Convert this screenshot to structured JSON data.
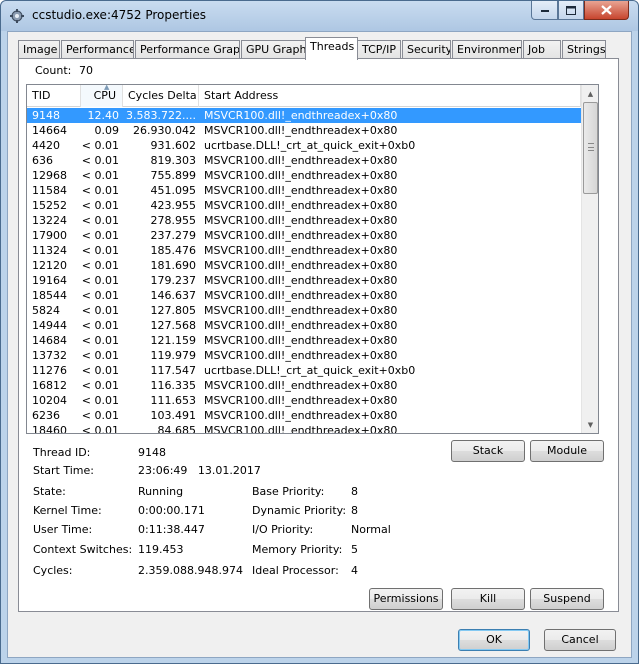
{
  "window": {
    "title": "ccstudio.exe:4752 Properties"
  },
  "tabs": [
    {
      "label": "Image"
    },
    {
      "label": "Performance"
    },
    {
      "label": "Performance Graph"
    },
    {
      "label": "GPU Graph"
    },
    {
      "label": "Threads"
    },
    {
      "label": "TCP/IP"
    },
    {
      "label": "Security"
    },
    {
      "label": "Environment"
    },
    {
      "label": "Job"
    },
    {
      "label": "Strings"
    }
  ],
  "active_tab": "Threads",
  "threads": {
    "count_label": "Count:",
    "count_value": "70",
    "columns": {
      "tid": "TID",
      "cpu": "CPU",
      "cycles_delta": "Cycles Delta",
      "start_address": "Start Address"
    },
    "sort_column": "CPU",
    "rows": [
      {
        "tid": "9148",
        "cpu": "12.40",
        "cycles": "3.583.722....",
        "addr": "MSVCR100.dll!_endthreadex+0x80",
        "selected": true
      },
      {
        "tid": "14664",
        "cpu": "0.09",
        "cycles": "26.930.042",
        "addr": "MSVCR100.dll!_endthreadex+0x80"
      },
      {
        "tid": "4420",
        "cpu": "< 0.01",
        "cycles": "931.602",
        "addr": "ucrtbase.DLL!_crt_at_quick_exit+0xb0"
      },
      {
        "tid": "636",
        "cpu": "< 0.01",
        "cycles": "819.303",
        "addr": "MSVCR100.dll!_endthreadex+0x80"
      },
      {
        "tid": "12968",
        "cpu": "< 0.01",
        "cycles": "755.899",
        "addr": "MSVCR100.dll!_endthreadex+0x80"
      },
      {
        "tid": "11584",
        "cpu": "< 0.01",
        "cycles": "451.095",
        "addr": "MSVCR100.dll!_endthreadex+0x80"
      },
      {
        "tid": "15252",
        "cpu": "< 0.01",
        "cycles": "423.955",
        "addr": "MSVCR100.dll!_endthreadex+0x80"
      },
      {
        "tid": "13224",
        "cpu": "< 0.01",
        "cycles": "278.955",
        "addr": "MSVCR100.dll!_endthreadex+0x80"
      },
      {
        "tid": "17900",
        "cpu": "< 0.01",
        "cycles": "237.279",
        "addr": "MSVCR100.dll!_endthreadex+0x80"
      },
      {
        "tid": "11324",
        "cpu": "< 0.01",
        "cycles": "185.476",
        "addr": "MSVCR100.dll!_endthreadex+0x80"
      },
      {
        "tid": "12120",
        "cpu": "< 0.01",
        "cycles": "181.690",
        "addr": "MSVCR100.dll!_endthreadex+0x80"
      },
      {
        "tid": "19164",
        "cpu": "< 0.01",
        "cycles": "179.237",
        "addr": "MSVCR100.dll!_endthreadex+0x80"
      },
      {
        "tid": "18544",
        "cpu": "< 0.01",
        "cycles": "146.637",
        "addr": "MSVCR100.dll!_endthreadex+0x80"
      },
      {
        "tid": "5824",
        "cpu": "< 0.01",
        "cycles": "127.805",
        "addr": "MSVCR100.dll!_endthreadex+0x80"
      },
      {
        "tid": "14944",
        "cpu": "< 0.01",
        "cycles": "127.568",
        "addr": "MSVCR100.dll!_endthreadex+0x80"
      },
      {
        "tid": "14684",
        "cpu": "< 0.01",
        "cycles": "121.159",
        "addr": "MSVCR100.dll!_endthreadex+0x80"
      },
      {
        "tid": "13732",
        "cpu": "< 0.01",
        "cycles": "119.979",
        "addr": "MSVCR100.dll!_endthreadex+0x80"
      },
      {
        "tid": "11276",
        "cpu": "< 0.01",
        "cycles": "117.547",
        "addr": "ucrtbase.DLL!_crt_at_quick_exit+0xb0"
      },
      {
        "tid": "16812",
        "cpu": "< 0.01",
        "cycles": "116.335",
        "addr": "MSVCR100.dll!_endthreadex+0x80"
      },
      {
        "tid": "10204",
        "cpu": "< 0.01",
        "cycles": "111.653",
        "addr": "MSVCR100.dll!_endthreadex+0x80"
      },
      {
        "tid": "6236",
        "cpu": "< 0.01",
        "cycles": "103.491",
        "addr": "MSVCR100.dll!_endthreadex+0x80"
      },
      {
        "tid": "18460",
        "cpu": "< 0.01",
        "cycles": "84.685",
        "addr": "MSVCR100.dll!_endthreadex+0x80"
      }
    ]
  },
  "details": {
    "thread_id_label": "Thread ID:",
    "thread_id_value": "9148",
    "start_time_label": "Start Time:",
    "start_time_value": "23:06:49   13.01.2017",
    "state_label": "State:",
    "state_value": "Running",
    "kernel_time_label": "Kernel Time:",
    "kernel_time_value": "0:00:00.171",
    "user_time_label": "User Time:",
    "user_time_value": "0:11:38.447",
    "context_switches_label": "Context Switches:",
    "context_switches_value": "119.453",
    "cycles_label": "Cycles:",
    "cycles_value": "2.359.088.948.974",
    "base_priority_label": "Base Priority:",
    "base_priority_value": "8",
    "dynamic_priority_label": "Dynamic Priority:",
    "dynamic_priority_value": "8",
    "io_priority_label": "I/O Priority:",
    "io_priority_value": "Normal",
    "memory_priority_label": "Memory Priority:",
    "memory_priority_value": "5",
    "ideal_processor_label": "Ideal Processor:",
    "ideal_processor_value": "4"
  },
  "buttons": {
    "stack": "Stack",
    "module": "Module",
    "permissions": "Permissions",
    "kill": "Kill",
    "suspend": "Suspend",
    "ok": "OK",
    "cancel": "Cancel"
  },
  "icons": {
    "app": "gear-app-icon",
    "minimize": "minimize-icon",
    "maximize": "maximize-icon",
    "close": "close-icon"
  },
  "colors": {
    "selection": "#3399ff",
    "close_button": "#c7452e",
    "title_bar": "#bcd3ea"
  }
}
